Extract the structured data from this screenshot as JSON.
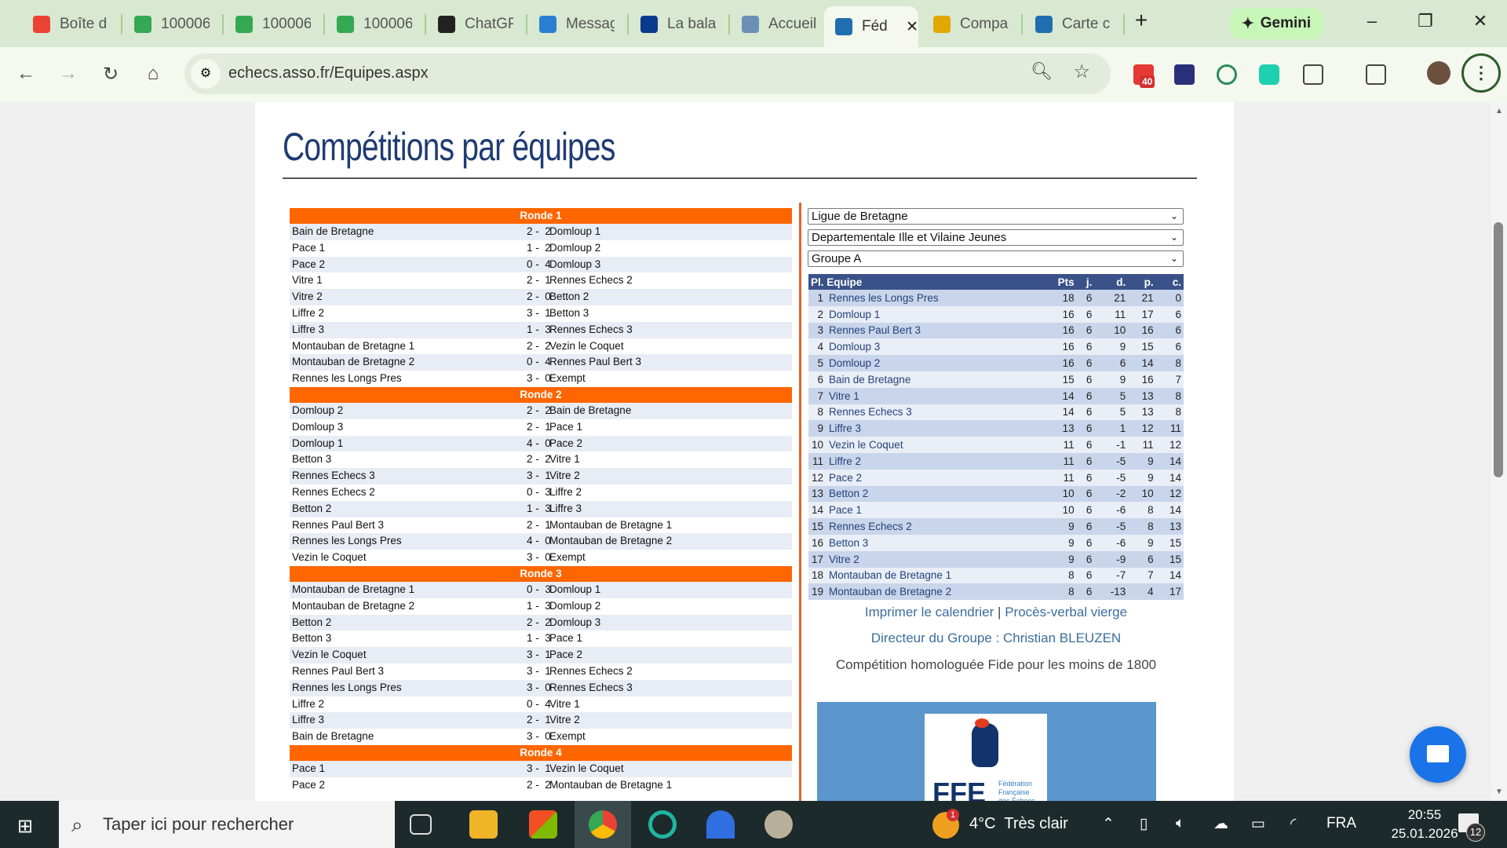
{
  "browser": {
    "tabs": [
      {
        "label": "Boîte d",
        "color": "#ea4335"
      },
      {
        "label": "100006",
        "color": "#34a853"
      },
      {
        "label": "100006",
        "color": "#34a853"
      },
      {
        "label": "100006",
        "color": "#34a853"
      },
      {
        "label": "ChatGP",
        "color": "#222222"
      },
      {
        "label": "Messag",
        "color": "#2a7fd0"
      },
      {
        "label": "La bala",
        "color": "#0a3a8c"
      },
      {
        "label": "Accueil",
        "color": "#6b8fb5"
      },
      {
        "label": "Féd",
        "color": "#1f6fb0"
      },
      {
        "label": "Compa",
        "color": "#e0a800"
      },
      {
        "label": "Carte c",
        "color": "#1f6fb0"
      }
    ],
    "active_tab": 8,
    "gemini_label": "Gemini",
    "url": "echecs.asso.fr/Equipes.aspx",
    "mail_badge": "40"
  },
  "page": {
    "title": "Compétitions par équipes",
    "selects": [
      "Ligue de Bretagne",
      "Departementale Ille et Vilaine Jeunes",
      "Groupe A"
    ],
    "rounds": [
      {
        "label": "Ronde 1",
        "matches": [
          [
            "Bain de Bretagne",
            "2 -  2",
            "Domloup 1"
          ],
          [
            "Pace 1",
            "1 -  2",
            "Domloup 2"
          ],
          [
            "Pace 2",
            "0 -  4",
            "Domloup 3"
          ],
          [
            "Vitre 1",
            "2 -  1",
            "Rennes Echecs 2"
          ],
          [
            "Vitre 2",
            "2 -  0",
            "Betton 2"
          ],
          [
            "Liffre 2",
            "3 -  1",
            "Betton 3"
          ],
          [
            "Liffre 3",
            "1 -  3",
            "Rennes Echecs 3"
          ],
          [
            "Montauban de Bretagne 1",
            "2 -  2",
            "Vezin le Coquet"
          ],
          [
            "Montauban de Bretagne 2",
            "0 -  4",
            "Rennes Paul Bert 3"
          ],
          [
            "Rennes les Longs Pres",
            "3 -  0",
            "Exempt"
          ]
        ]
      },
      {
        "label": "Ronde 2",
        "matches": [
          [
            "Domloup 2",
            "2 -  2",
            "Bain de Bretagne"
          ],
          [
            "Domloup 3",
            "2 -  1",
            "Pace 1"
          ],
          [
            "Domloup 1",
            "4 -  0",
            "Pace 2"
          ],
          [
            "Betton 3",
            "2 -  2",
            "Vitre 1"
          ],
          [
            "Rennes Echecs 3",
            "3 -  1",
            "Vitre 2"
          ],
          [
            "Rennes Echecs 2",
            "0 -  3",
            "Liffre 2"
          ],
          [
            "Betton 2",
            "1 -  3",
            "Liffre 3"
          ],
          [
            "Rennes Paul Bert 3",
            "2 -  1",
            "Montauban de Bretagne 1"
          ],
          [
            "Rennes les Longs Pres",
            "4 -  0",
            "Montauban de Bretagne 2"
          ],
          [
            "Vezin le Coquet",
            "3 -  0",
            "Exempt"
          ]
        ]
      },
      {
        "label": "Ronde 3",
        "matches": [
          [
            "Montauban de Bretagne 1",
            "0 -  3",
            "Domloup 1"
          ],
          [
            "Montauban de Bretagne 2",
            "1 -  3",
            "Domloup 2"
          ],
          [
            "Betton 2",
            "2 -  2",
            "Domloup 3"
          ],
          [
            "Betton 3",
            "1 -  3",
            "Pace 1"
          ],
          [
            "Vezin le Coquet",
            "3 -  1",
            "Pace 2"
          ],
          [
            "Rennes Paul Bert 3",
            "3 -  1",
            "Rennes Echecs 2"
          ],
          [
            "Rennes les Longs Pres",
            "3 -  0",
            "Rennes Echecs 3"
          ],
          [
            "Liffre 2",
            "0 -  4",
            "Vitre 1"
          ],
          [
            "Liffre 3",
            "2 -  1",
            "Vitre 2"
          ],
          [
            "Bain de Bretagne",
            "3 -  0",
            "Exempt"
          ]
        ]
      },
      {
        "label": "Ronde 4",
        "matches": [
          [
            "Pace 1",
            "3 -  1",
            "Vezin le Coquet"
          ],
          [
            "Pace 2",
            "2 -  2",
            "Montauban de Bretagne 1"
          ]
        ]
      }
    ],
    "standings_headers": [
      "Pl. Equipe",
      "Pts",
      "j.",
      "d.",
      "p.",
      "c."
    ],
    "standings": [
      [
        "1",
        "Rennes les Longs Pres",
        "18",
        "6",
        "21",
        "21",
        "0"
      ],
      [
        "2",
        "Domloup 1",
        "16",
        "6",
        "11",
        "17",
        "6"
      ],
      [
        "3",
        "Rennes Paul Bert 3",
        "16",
        "6",
        "10",
        "16",
        "6"
      ],
      [
        "4",
        "Domloup 3",
        "16",
        "6",
        "9",
        "15",
        "6"
      ],
      [
        "5",
        "Domloup 2",
        "16",
        "6",
        "6",
        "14",
        "8"
      ],
      [
        "6",
        "Bain de Bretagne",
        "15",
        "6",
        "9",
        "16",
        "7"
      ],
      [
        "7",
        "Vitre 1",
        "14",
        "6",
        "5",
        "13",
        "8"
      ],
      [
        "8",
        "Rennes Echecs 3",
        "14",
        "6",
        "5",
        "13",
        "8"
      ],
      [
        "9",
        "Liffre 3",
        "13",
        "6",
        "1",
        "12",
        "11"
      ],
      [
        "10",
        "Vezin le Coquet",
        "11",
        "6",
        "-1",
        "11",
        "12"
      ],
      [
        "11",
        "Liffre 2",
        "11",
        "6",
        "-5",
        "9",
        "14"
      ],
      [
        "12",
        "Pace 2",
        "11",
        "6",
        "-5",
        "9",
        "14"
      ],
      [
        "13",
        "Betton 2",
        "10",
        "6",
        "-2",
        "10",
        "12"
      ],
      [
        "14",
        "Pace 1",
        "10",
        "6",
        "-6",
        "8",
        "14"
      ],
      [
        "15",
        "Rennes Echecs 2",
        "9",
        "6",
        "-5",
        "8",
        "13"
      ],
      [
        "16",
        "Betton 3",
        "9",
        "6",
        "-6",
        "9",
        "15"
      ],
      [
        "17",
        "Vitre 2",
        "9",
        "6",
        "-9",
        "6",
        "15"
      ],
      [
        "18",
        "Montauban de Bretagne 1",
        "8",
        "6",
        "-7",
        "7",
        "14"
      ],
      [
        "19",
        "Montauban de Bretagne 2",
        "8",
        "6",
        "-13",
        "4",
        "17"
      ]
    ],
    "print_link": "Imprimer le calendrier",
    "link_sep": "|",
    "pv_link": "Procès-verbal vierge",
    "director": "Directeur du Groupe : Christian BLEUZEN",
    "fide_note": "Compétition homologuée Fide pour les moins de 1800",
    "logo_text": "FFE Fédération Française des Échecs"
  },
  "taskbar": {
    "search_placeholder": "Taper ici pour rechercher",
    "weather_badge": "1",
    "temperature": "4°C",
    "weather": "Très clair",
    "language": "FRA",
    "time": "20:55",
    "date": "25.01.2026",
    "notif_count": "12"
  }
}
